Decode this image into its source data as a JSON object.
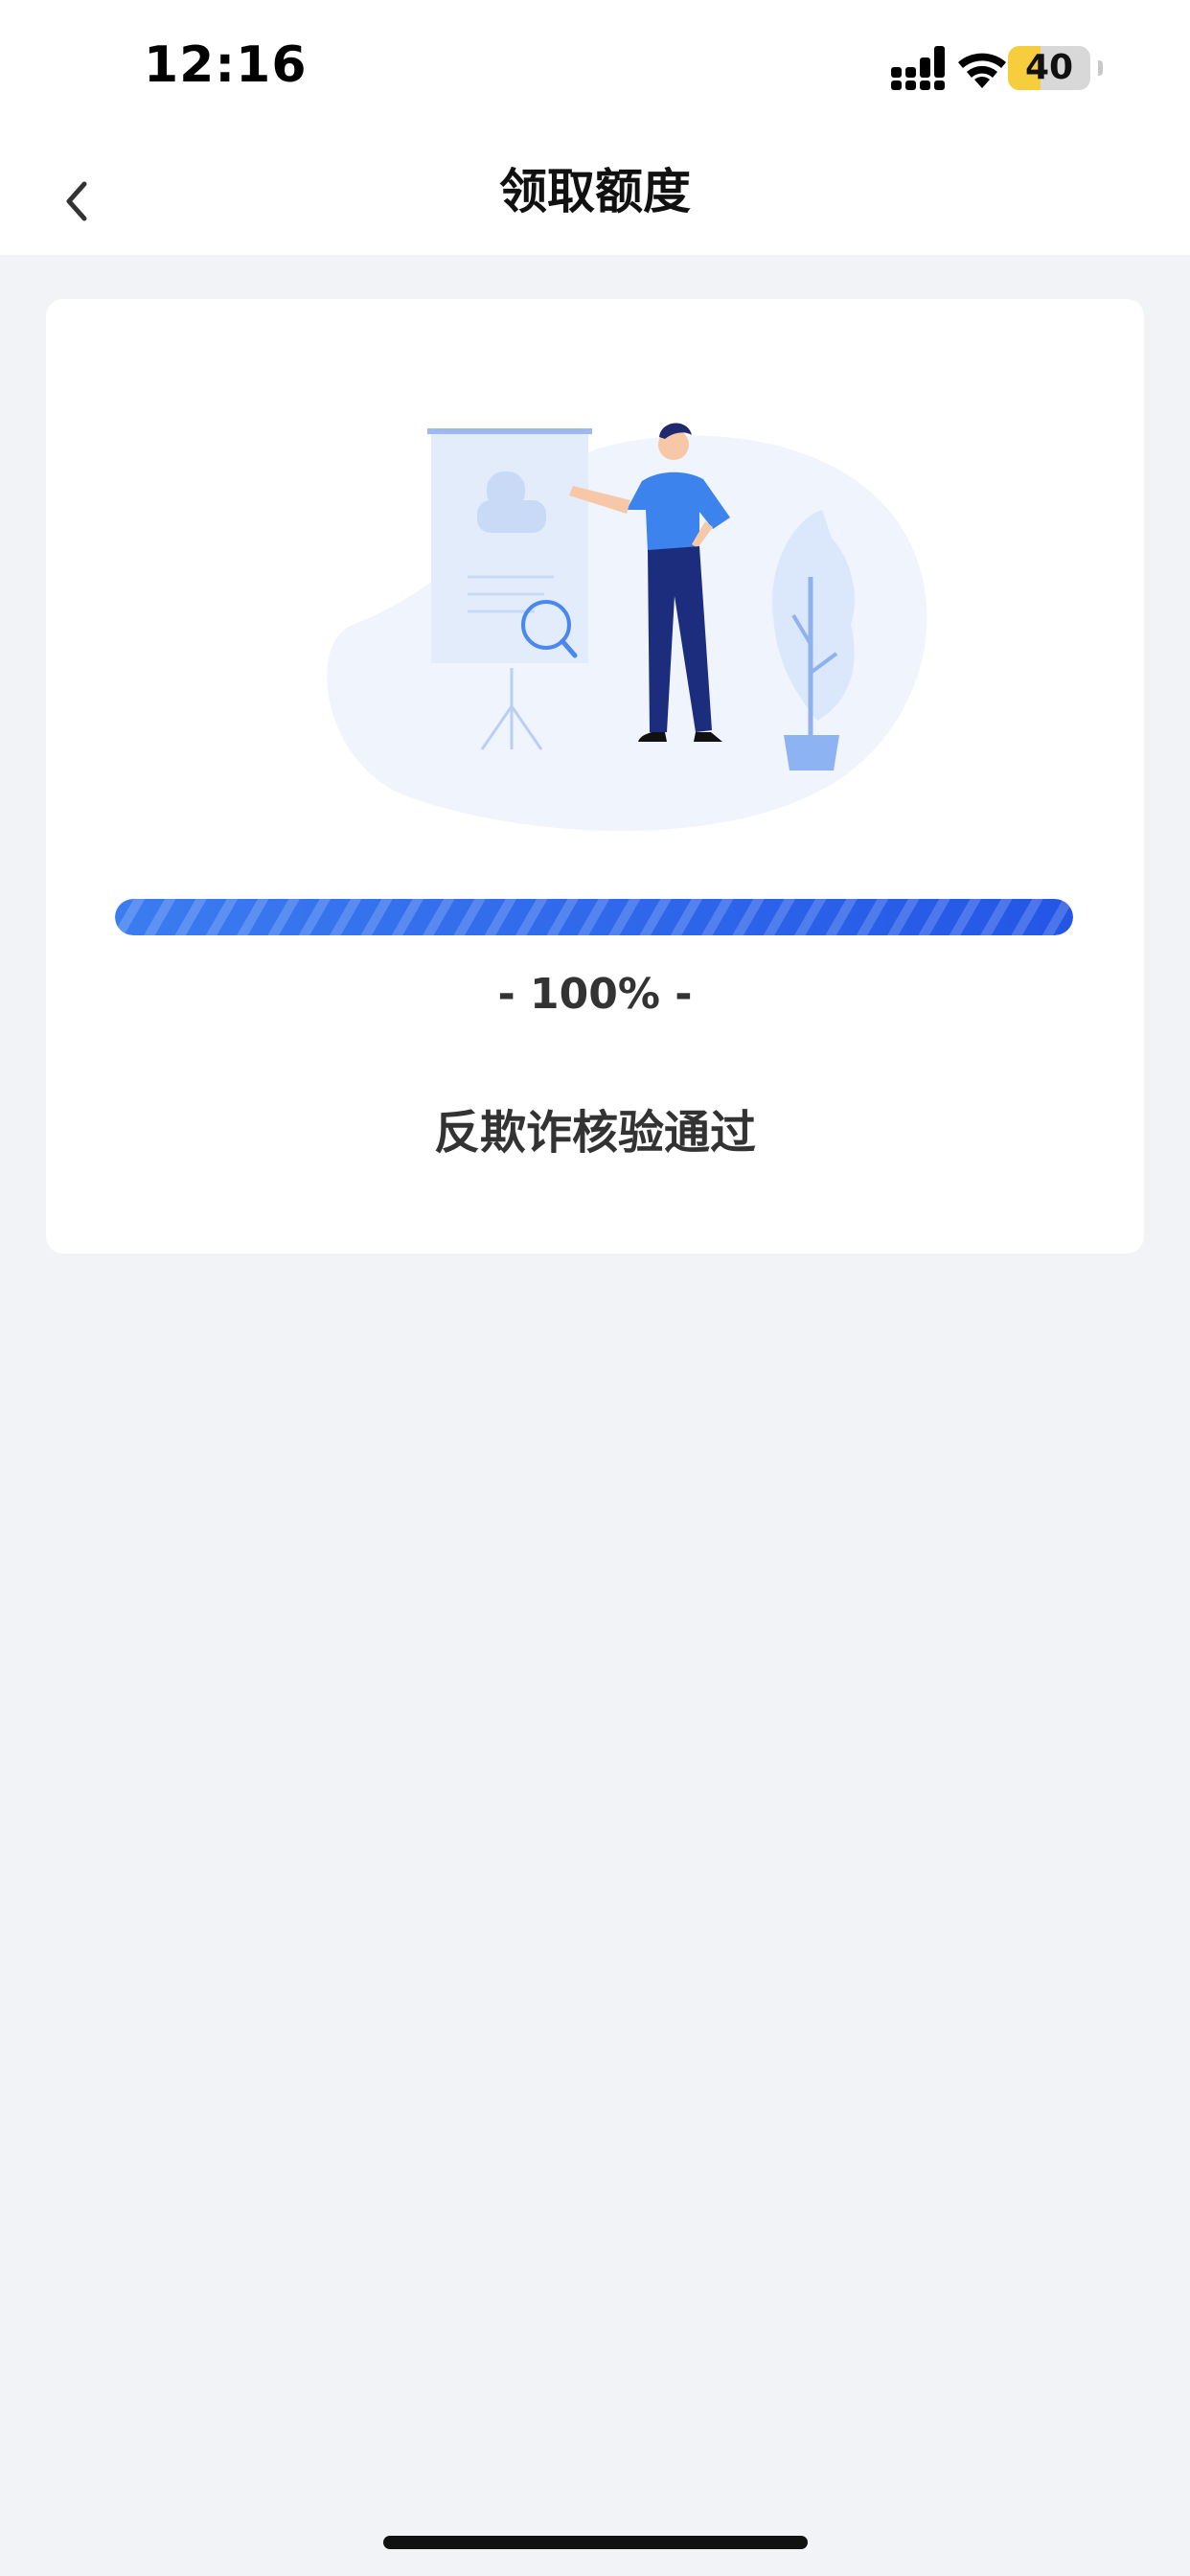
{
  "status_bar": {
    "time": "12:16",
    "battery_level": "40",
    "battery_fraction": 0.4,
    "icons": [
      "signal-icon",
      "wifi-icon",
      "battery-icon"
    ]
  },
  "nav": {
    "title": "领取额度",
    "back_icon": "chevron-left-icon"
  },
  "verification": {
    "progress_percent": 100,
    "progress_label": "- 100% -",
    "message": "反欺诈核验通过"
  },
  "colors": {
    "accent": "#2456e6",
    "background": "#f2f3f6",
    "card": "#ffffff"
  }
}
